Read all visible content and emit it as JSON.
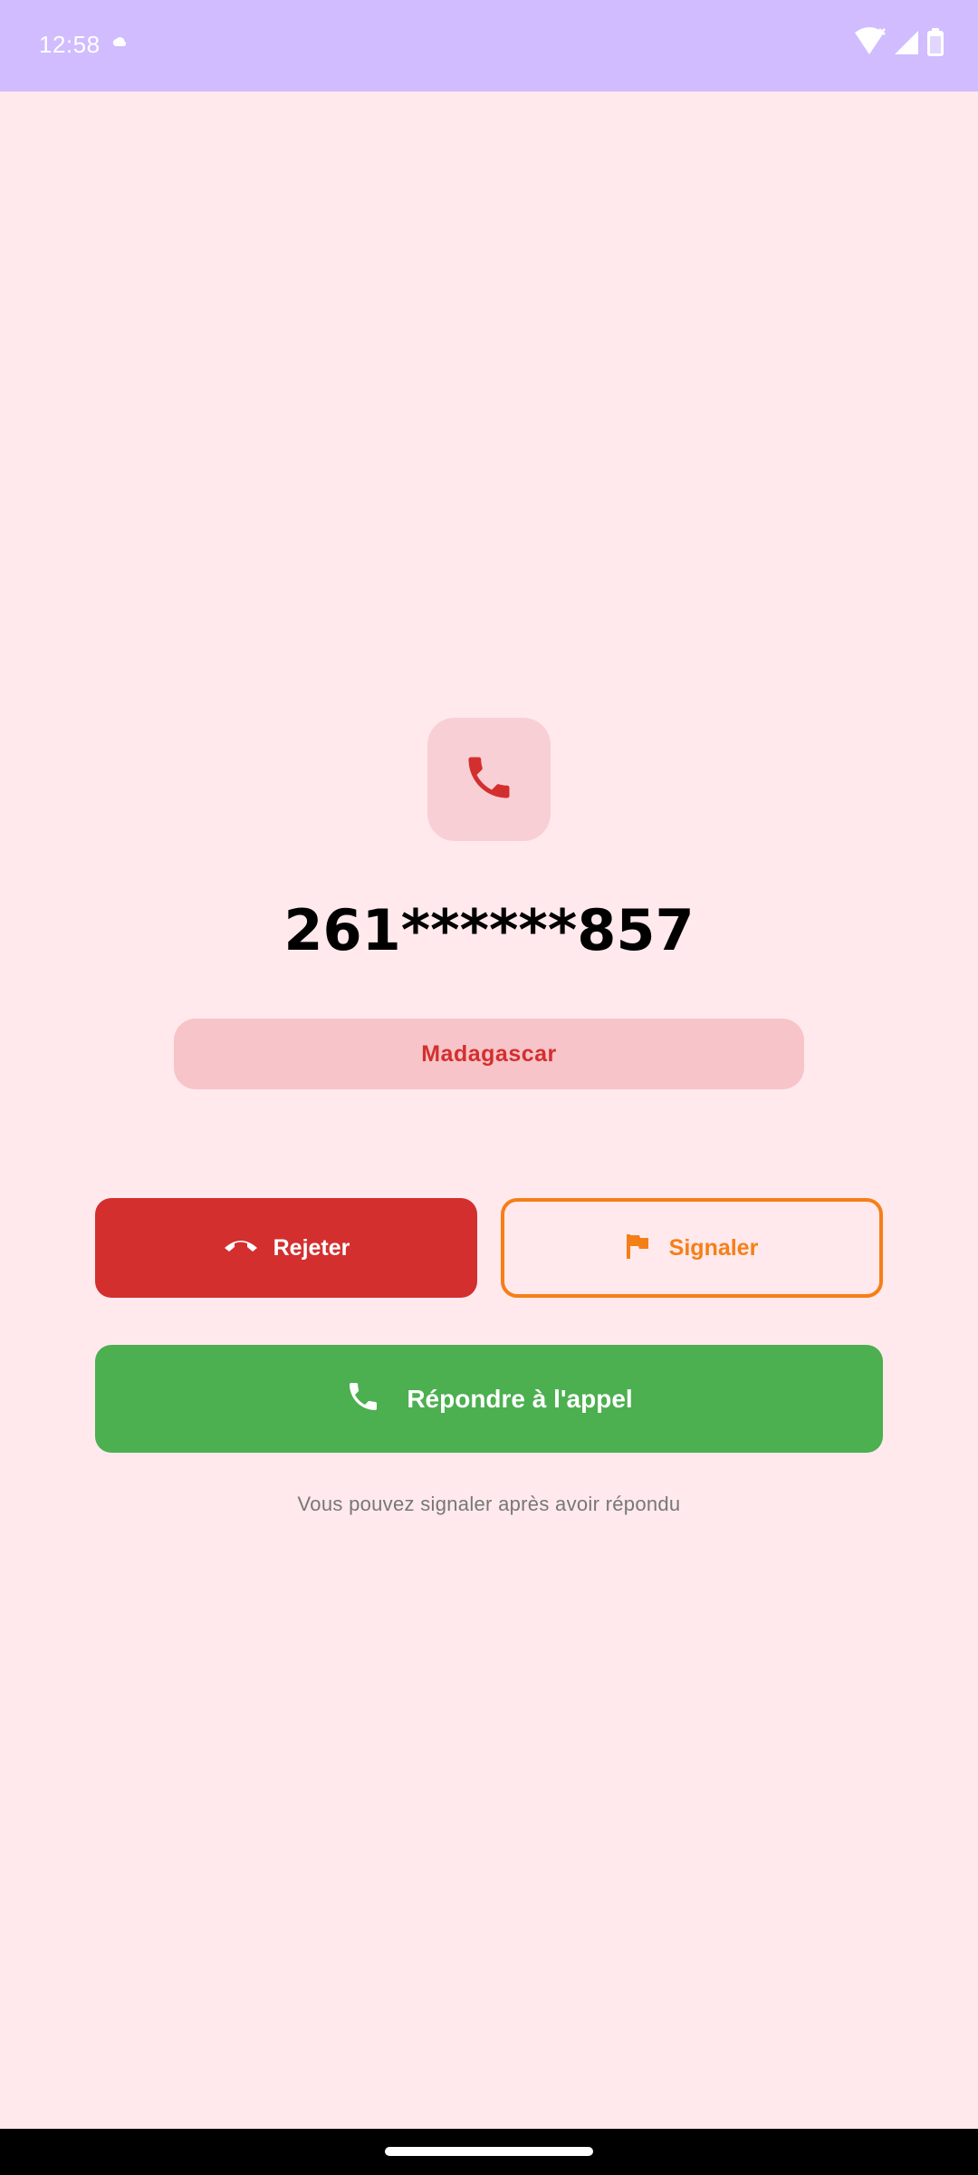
{
  "status_bar": {
    "time": "12:58",
    "icons": [
      "cloud-icon",
      "wifi-icon",
      "signal-icon",
      "battery-icon"
    ]
  },
  "caller": {
    "icon": "phone-icon",
    "number": "261******857",
    "country": "Madagascar"
  },
  "actions": {
    "reject_label": "Rejeter",
    "report_label": "Signaler",
    "answer_label": "Répondre à l'appel"
  },
  "hint": "Vous pouvez signaler après avoir répondu",
  "colors": {
    "background": "#FFE9EC",
    "status_bar": "#D0BCFF",
    "reject": "#D32F2F",
    "report": "#F57F17",
    "answer": "#4CAF50",
    "country_badge": "#F6C4C9",
    "icon_box": "#F8CFD4"
  }
}
